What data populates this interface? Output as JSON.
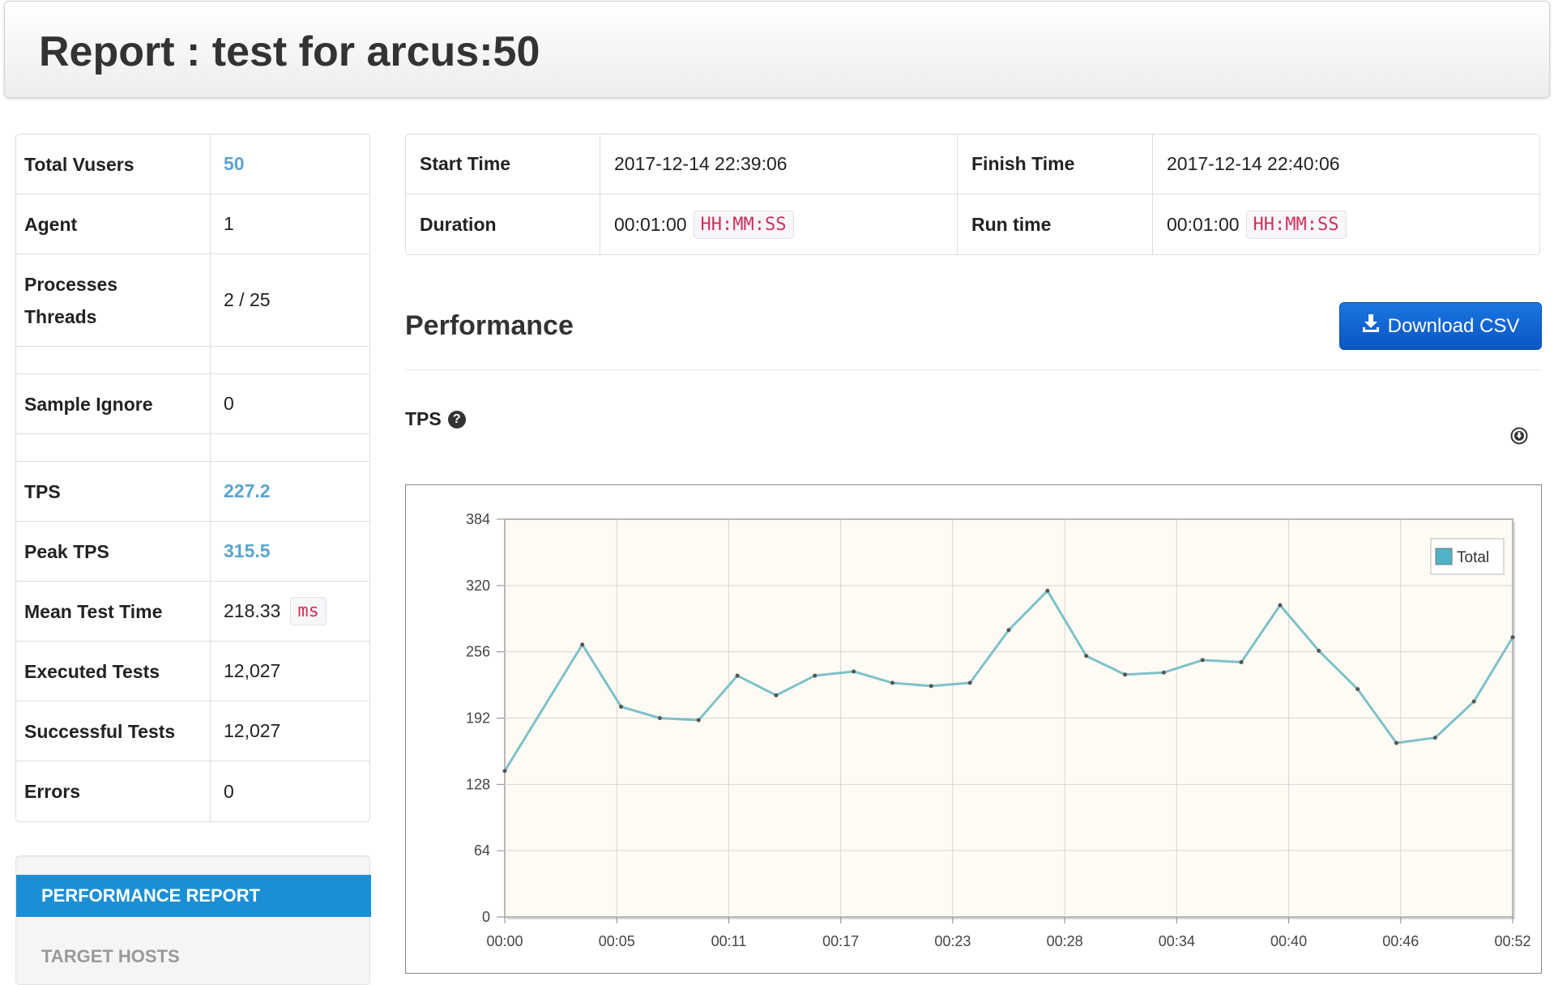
{
  "header": {
    "title": "Report : test for arcus:50"
  },
  "summary": {
    "rows": [
      {
        "key": "Total Vusers",
        "value": "50"
      },
      {
        "key": "Agent",
        "value": "1"
      },
      {
        "key_line1": "Processes",
        "key_line2": "Threads",
        "value": "2 / 25"
      },
      {
        "key": "Sample Ignore",
        "value": "0"
      },
      {
        "key": "TPS",
        "value": "227.2"
      },
      {
        "key": "Peak TPS",
        "value": "315.5"
      },
      {
        "key": "Mean Test Time",
        "value": "218.33",
        "unit": "ms"
      },
      {
        "key": "Executed Tests",
        "value": "12,027"
      },
      {
        "key": "Successful Tests",
        "value": "12,027"
      },
      {
        "key": "Errors",
        "value": "0"
      }
    ]
  },
  "times": {
    "start_label": "Start Time",
    "start_value": "2017-12-14 22:39:06",
    "finish_label": "Finish Time",
    "finish_value": "2017-12-14 22:40:06",
    "duration_label": "Duration",
    "duration_value": "00:01:00",
    "duration_unit": "HH:MM:SS",
    "runtime_label": "Run time",
    "runtime_value": "00:01:00",
    "runtime_unit": "HH:MM:SS"
  },
  "performance": {
    "title": "Performance",
    "download_label": "Download CSV",
    "tps_label": "TPS",
    "help_glyph": "?"
  },
  "nav": {
    "items": [
      {
        "label": "PERFORMANCE REPORT",
        "active": true
      },
      {
        "label": "TARGET HOSTS",
        "active": false
      }
    ]
  },
  "colors": {
    "series": "#7fc1c9",
    "legend_swatch": "#4fb3c8",
    "plot_bg": "#fdfbf3",
    "link": "#5ba4cf",
    "active_nav": "#1b8fd5"
  },
  "chart_data": {
    "type": "line",
    "title": "",
    "xlabel": "",
    "ylabel": "",
    "ylim": [
      0,
      384
    ],
    "y_ticks": [
      0,
      64,
      128,
      192,
      256,
      320,
      384
    ],
    "x_ticks": [
      "00:00",
      "00:05",
      "00:11",
      "00:17",
      "00:23",
      "00:28",
      "00:34",
      "00:40",
      "00:46",
      "00:52"
    ],
    "x_range_seconds": [
      0,
      52
    ],
    "legend": "top-right",
    "grid": true,
    "series": [
      {
        "name": "Total",
        "x_seconds": [
          0,
          4,
          6,
          8,
          10,
          12,
          14,
          16,
          18,
          20,
          22,
          24,
          26,
          28,
          30,
          32,
          34,
          36,
          38,
          40,
          42,
          44,
          46,
          48,
          50,
          52
        ],
        "values": [
          141,
          263,
          203,
          192,
          190,
          233,
          214,
          233,
          237,
          226,
          223,
          226,
          277,
          315,
          252,
          234,
          236,
          248,
          246,
          301,
          257,
          220,
          168,
          173,
          208,
          270
        ]
      }
    ]
  }
}
